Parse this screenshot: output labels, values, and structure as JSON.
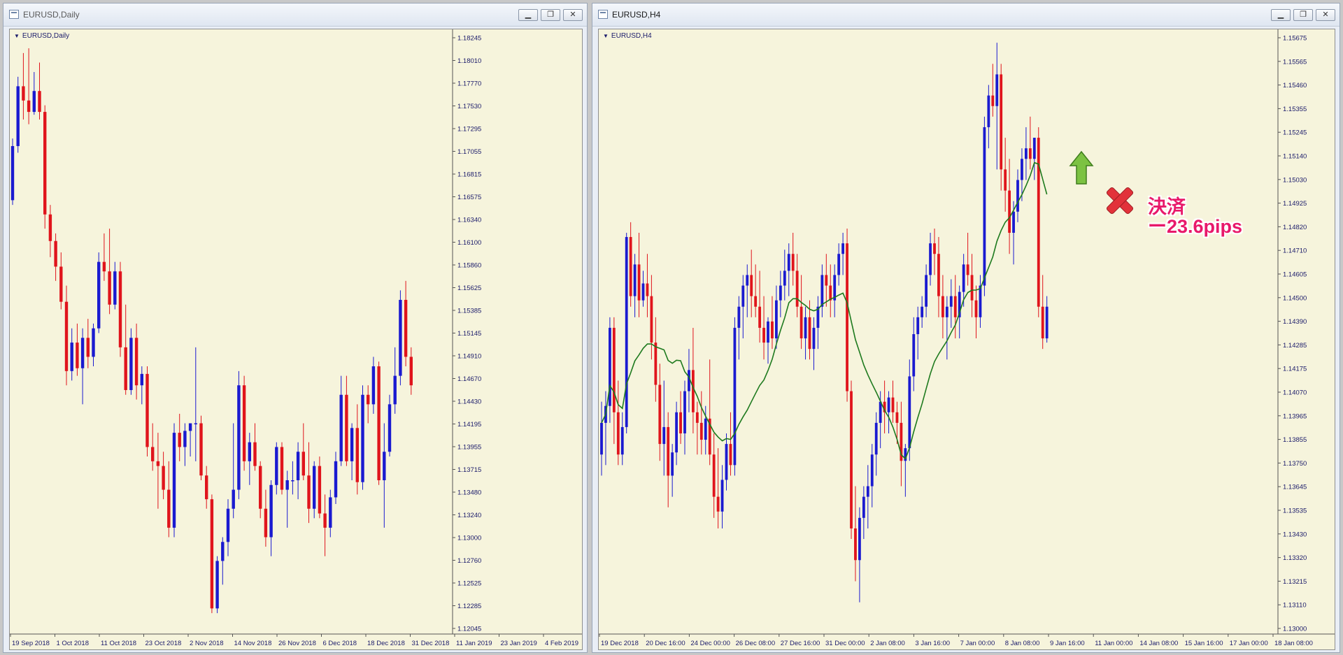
{
  "colors": {
    "bull": "#1a1ad0",
    "bear": "#e0141c",
    "ma": "#1e7a1e",
    "bg": "#f6f4dc",
    "axis": "#1a1a6a"
  },
  "left_window": {
    "title": "EURUSD,Daily",
    "symbol_label": "EURUSD,Daily",
    "buttons": [
      "minimize-icon",
      "restore-icon",
      "close-icon"
    ],
    "y_axis": [
      "1.18245",
      "1.18010",
      "1.17770",
      "1.17530",
      "1.17295",
      "1.17055",
      "1.16815",
      "1.16575",
      "1.16340",
      "1.16100",
      "1.15860",
      "1.15625",
      "1.15385",
      "1.15145",
      "1.14910",
      "1.14670",
      "1.14430",
      "1.14195",
      "1.13955",
      "1.13715",
      "1.13480",
      "1.13240",
      "1.13000",
      "1.12760",
      "1.12525",
      "1.12285",
      "1.12045"
    ],
    "x_axis": [
      "19 Sep 2018",
      "1 Oct 2018",
      "11 Oct 2018",
      "23 Oct 2018",
      "2 Nov 2018",
      "14 Nov 2018",
      "26 Nov 2018",
      "6 Dec 2018",
      "18 Dec 2018",
      "31 Dec 2018",
      "11 Jan 2019",
      "23 Jan 2019",
      "4 Feb 2019"
    ]
  },
  "right_window": {
    "title": "EURUSD,H4",
    "symbol_label": "EURUSD,H4",
    "buttons": [
      "minimize-icon",
      "restore-icon",
      "close-icon"
    ],
    "y_axis": [
      "1.15675",
      "1.15565",
      "1.15460",
      "1.15355",
      "1.15245",
      "1.15140",
      "1.15030",
      "1.14925",
      "1.14820",
      "1.14710",
      "1.14605",
      "1.14500",
      "1.14390",
      "1.14285",
      "1.14175",
      "1.14070",
      "1.13965",
      "1.13855",
      "1.13750",
      "1.13645",
      "1.13535",
      "1.13430",
      "1.13320",
      "1.13215",
      "1.13110",
      "1.13000"
    ],
    "x_axis": [
      "19 Dec 2018",
      "20 Dec 16:00",
      "24 Dec 00:00",
      "26 Dec 08:00",
      "27 Dec 16:00",
      "31 Dec 00:00",
      "2 Jan 08:00",
      "3 Jan 16:00",
      "7 Jan 00:00",
      "8 Jan 08:00",
      "9 Jan 16:00",
      "11 Jan 00:00",
      "14 Jan 08:00",
      "15 Jan 16:00",
      "17 Jan 00:00",
      "18 Jan 08:00"
    ],
    "annotation": {
      "line1": "決済",
      "line2": "ー23.6pips",
      "entry_icon": "up-arrow-icon",
      "exit_icon": "x-mark-icon"
    }
  },
  "chart_data": [
    {
      "type": "candlestick",
      "title": "EURUSD,Daily",
      "ylim": [
        1.1198,
        1.1832
      ],
      "x_ticks": [
        "19 Sep 2018",
        "1 Oct 2018",
        "11 Oct 2018",
        "23 Oct 2018",
        "2 Nov 2018",
        "14 Nov 2018",
        "26 Nov 2018",
        "6 Dec 2018",
        "18 Dec 2018",
        "31 Dec 2018",
        "11 Jan 2019",
        "23 Jan 2019",
        "4 Feb 2019"
      ],
      "ohlc": [
        [
          1.1655,
          1.172,
          1.165,
          1.1712
        ],
        [
          1.1712,
          1.1785,
          1.1705,
          1.1775
        ],
        [
          1.1775,
          1.181,
          1.174,
          1.176
        ],
        [
          1.176,
          1.1815,
          1.1735,
          1.1748
        ],
        [
          1.1748,
          1.179,
          1.1745,
          1.177
        ],
        [
          1.177,
          1.18,
          1.174,
          1.1748
        ],
        [
          1.1748,
          1.1755,
          1.1625,
          1.164
        ],
        [
          1.164,
          1.165,
          1.1595,
          1.1612
        ],
        [
          1.1612,
          1.162,
          1.157,
          1.1585
        ],
        [
          1.1585,
          1.16,
          1.154,
          1.1548
        ],
        [
          1.1548,
          1.1565,
          1.146,
          1.1475
        ],
        [
          1.1475,
          1.152,
          1.1465,
          1.1505
        ],
        [
          1.1505,
          1.1525,
          1.147,
          1.1478
        ],
        [
          1.1478,
          1.152,
          1.144,
          1.151
        ],
        [
          1.151,
          1.153,
          1.1478,
          1.149
        ],
        [
          1.149,
          1.1525,
          1.148,
          1.152
        ],
        [
          1.152,
          1.16,
          1.1515,
          1.159
        ],
        [
          1.159,
          1.162,
          1.157,
          1.158
        ],
        [
          1.158,
          1.1625,
          1.1535,
          1.1545
        ],
        [
          1.1545,
          1.159,
          1.154,
          1.158
        ],
        [
          1.158,
          1.159,
          1.149,
          1.15
        ],
        [
          1.15,
          1.1545,
          1.145,
          1.1455
        ],
        [
          1.1455,
          1.152,
          1.145,
          1.151
        ],
        [
          1.151,
          1.1525,
          1.1445,
          1.146
        ],
        [
          1.146,
          1.148,
          1.144,
          1.1472
        ],
        [
          1.1472,
          1.148,
          1.1385,
          1.1395
        ],
        [
          1.1395,
          1.142,
          1.137,
          1.138
        ],
        [
          1.138,
          1.141,
          1.133,
          1.1375
        ],
        [
          1.1375,
          1.139,
          1.134,
          1.135
        ],
        [
          1.135,
          1.138,
          1.13,
          1.131
        ],
        [
          1.131,
          1.142,
          1.13,
          1.141
        ],
        [
          1.141,
          1.143,
          1.138,
          1.1395
        ],
        [
          1.1395,
          1.142,
          1.1375,
          1.1412
        ],
        [
          1.1412,
          1.142,
          1.1385,
          1.142
        ],
        [
          1.142,
          1.15,
          1.138,
          1.142
        ],
        [
          1.142,
          1.1428,
          1.136,
          1.1365
        ],
        [
          1.1365,
          1.1375,
          1.133,
          1.134
        ],
        [
          1.134,
          1.1345,
          1.122,
          1.1225
        ],
        [
          1.1225,
          1.128,
          1.122,
          1.1275
        ],
        [
          1.1275,
          1.13,
          1.125,
          1.1295
        ],
        [
          1.1295,
          1.134,
          1.128,
          1.133
        ],
        [
          1.133,
          1.142,
          1.132,
          1.135
        ],
        [
          1.135,
          1.1475,
          1.134,
          1.146
        ],
        [
          1.146,
          1.147,
          1.137,
          1.138
        ],
        [
          1.138,
          1.141,
          1.1355,
          1.14
        ],
        [
          1.14,
          1.142,
          1.137,
          1.1375
        ],
        [
          1.1375,
          1.138,
          1.132,
          1.133
        ],
        [
          1.133,
          1.135,
          1.129,
          1.13
        ],
        [
          1.13,
          1.136,
          1.128,
          1.1355
        ],
        [
          1.1355,
          1.14,
          1.1345,
          1.1395
        ],
        [
          1.1395,
          1.14,
          1.1345,
          1.135
        ],
        [
          1.135,
          1.137,
          1.131,
          1.136
        ],
        [
          1.136,
          1.138,
          1.1345,
          1.136
        ],
        [
          1.136,
          1.14,
          1.134,
          1.139
        ],
        [
          1.139,
          1.142,
          1.136,
          1.1365
        ],
        [
          1.1365,
          1.14,
          1.1315,
          1.133
        ],
        [
          1.133,
          1.138,
          1.132,
          1.1375
        ],
        [
          1.1375,
          1.1385,
          1.132,
          1.1325
        ],
        [
          1.1325,
          1.1345,
          1.128,
          1.131
        ],
        [
          1.131,
          1.135,
          1.13,
          1.1342
        ],
        [
          1.1342,
          1.139,
          1.1335,
          1.138
        ],
        [
          1.138,
          1.147,
          1.1375,
          1.145
        ],
        [
          1.145,
          1.147,
          1.1375,
          1.138
        ],
        [
          1.138,
          1.142,
          1.136,
          1.1415
        ],
        [
          1.1415,
          1.144,
          1.1345,
          1.1358
        ],
        [
          1.1358,
          1.146,
          1.135,
          1.145
        ],
        [
          1.145,
          1.146,
          1.142,
          1.144
        ],
        [
          1.144,
          1.149,
          1.143,
          1.148
        ],
        [
          1.148,
          1.1485,
          1.1355,
          1.136
        ],
        [
          1.136,
          1.142,
          1.131,
          1.139
        ],
        [
          1.139,
          1.145,
          1.1385,
          1.144
        ],
        [
          1.144,
          1.15,
          1.143,
          1.147
        ],
        [
          1.147,
          1.156,
          1.146,
          1.155
        ],
        [
          1.155,
          1.157,
          1.148,
          1.149
        ],
        [
          1.149,
          1.15,
          1.145,
          1.146
        ]
      ]
    },
    {
      "type": "candlestick",
      "title": "EURUSD,H4",
      "ylim": [
        1.129,
        1.1575
      ],
      "x_ticks": [
        "19 Dec 2018",
        "20 Dec 16:00",
        "24 Dec 00:00",
        "26 Dec 08:00",
        "27 Dec 16:00",
        "31 Dec 00:00",
        "2 Jan 08:00",
        "3 Jan 16:00",
        "7 Jan 00:00",
        "8 Jan 08:00",
        "9 Jan 16:00",
        "11 Jan 00:00",
        "14 Jan 08:00",
        "15 Jan 16:00",
        "17 Jan 00:00",
        "18 Jan 08:00"
      ],
      "moving_average": "green line shown (smoothing of closes)",
      "ohlc": [
        [
          1.1375,
          1.14,
          1.1365,
          1.139
        ],
        [
          1.139,
          1.1405,
          1.137,
          1.1398
        ],
        [
          1.1398,
          1.144,
          1.139,
          1.1435
        ],
        [
          1.1435,
          1.144,
          1.138,
          1.1395
        ],
        [
          1.1395,
          1.141,
          1.137,
          1.1375
        ],
        [
          1.1375,
          1.1395,
          1.137,
          1.1388
        ],
        [
          1.1388,
          1.148,
          1.1385,
          1.1478
        ],
        [
          1.1478,
          1.1485,
          1.1445,
          1.145
        ],
        [
          1.145,
          1.147,
          1.144,
          1.1465
        ],
        [
          1.1465,
          1.148,
          1.144,
          1.1448
        ],
        [
          1.1448,
          1.1462,
          1.1445,
          1.1456
        ],
        [
          1.1456,
          1.147,
          1.144,
          1.145
        ],
        [
          1.145,
          1.146,
          1.142,
          1.1428
        ],
        [
          1.1428,
          1.144,
          1.14,
          1.1408
        ],
        [
          1.1408,
          1.1418,
          1.1372,
          1.138
        ],
        [
          1.138,
          1.141,
          1.1365,
          1.1388
        ],
        [
          1.1388,
          1.1395,
          1.135,
          1.1365
        ],
        [
          1.1365,
          1.138,
          1.1355,
          1.1376
        ],
        [
          1.1376,
          1.14,
          1.137,
          1.1395
        ],
        [
          1.1395,
          1.1405,
          1.138,
          1.1385
        ],
        [
          1.1385,
          1.141,
          1.1375,
          1.1405
        ],
        [
          1.1405,
          1.1425,
          1.1395,
          1.1415
        ],
        [
          1.1415,
          1.1435,
          1.1385,
          1.1395
        ],
        [
          1.1395,
          1.14,
          1.1375,
          1.139
        ],
        [
          1.139,
          1.1405,
          1.1375,
          1.1382
        ],
        [
          1.1382,
          1.1398,
          1.1375,
          1.1392
        ],
        [
          1.1392,
          1.142,
          1.137,
          1.1375
        ],
        [
          1.1375,
          1.1385,
          1.1345,
          1.1355
        ],
        [
          1.1355,
          1.1378,
          1.134,
          1.1348
        ],
        [
          1.1348,
          1.137,
          1.134,
          1.1363
        ],
        [
          1.1363,
          1.1385,
          1.1358,
          1.138
        ],
        [
          1.138,
          1.1395,
          1.1365,
          1.137
        ],
        [
          1.137,
          1.144,
          1.1365,
          1.1435
        ],
        [
          1.1435,
          1.145,
          1.142,
          1.1445
        ],
        [
          1.1445,
          1.146,
          1.143,
          1.1455
        ],
        [
          1.1455,
          1.1465,
          1.144,
          1.146
        ],
        [
          1.146,
          1.1472,
          1.144,
          1.145
        ],
        [
          1.145,
          1.1465,
          1.144,
          1.1445
        ],
        [
          1.1445,
          1.1462,
          1.1428,
          1.1435
        ],
        [
          1.1435,
          1.145,
          1.142,
          1.1428
        ],
        [
          1.1428,
          1.144,
          1.1418,
          1.1438
        ],
        [
          1.1438,
          1.145,
          1.1425,
          1.143
        ],
        [
          1.143,
          1.1455,
          1.1425,
          1.1448
        ],
        [
          1.1448,
          1.1462,
          1.144,
          1.1455
        ],
        [
          1.1455,
          1.1472,
          1.1448,
          1.1462
        ],
        [
          1.1462,
          1.1475,
          1.145,
          1.147
        ],
        [
          1.147,
          1.148,
          1.1455,
          1.1462
        ],
        [
          1.1462,
          1.147,
          1.144,
          1.1445
        ],
        [
          1.1445,
          1.146,
          1.1425,
          1.143
        ],
        [
          1.143,
          1.1445,
          1.142,
          1.144
        ],
        [
          1.144,
          1.1448,
          1.142,
          1.1425
        ],
        [
          1.1425,
          1.144,
          1.1415,
          1.1435
        ],
        [
          1.1435,
          1.145,
          1.1425,
          1.1445
        ],
        [
          1.1445,
          1.1465,
          1.144,
          1.146
        ],
        [
          1.146,
          1.147,
          1.1445,
          1.1455
        ],
        [
          1.1455,
          1.1465,
          1.144,
          1.1448
        ],
        [
          1.1448,
          1.1465,
          1.144,
          1.146
        ],
        [
          1.146,
          1.1475,
          1.1455,
          1.147
        ],
        [
          1.147,
          1.148,
          1.146,
          1.1475
        ],
        [
          1.1475,
          1.1482,
          1.14,
          1.1405
        ],
        [
          1.1405,
          1.141,
          1.1335,
          1.134
        ],
        [
          1.134,
          1.136,
          1.1315,
          1.1325
        ],
        [
          1.1325,
          1.135,
          1.1305,
          1.1345
        ],
        [
          1.1345,
          1.136,
          1.1335,
          1.1355
        ],
        [
          1.1355,
          1.137,
          1.134,
          1.136
        ],
        [
          1.136,
          1.138,
          1.135,
          1.1375
        ],
        [
          1.1375,
          1.1395,
          1.1365,
          1.139
        ],
        [
          1.139,
          1.1405,
          1.1378,
          1.14
        ],
        [
          1.14,
          1.141,
          1.1385,
          1.1395
        ],
        [
          1.1395,
          1.1405,
          1.1385,
          1.1402
        ],
        [
          1.1402,
          1.141,
          1.139,
          1.1395
        ],
        [
          1.1395,
          1.14,
          1.138,
          1.139
        ],
        [
          1.139,
          1.14,
          1.136,
          1.1372
        ],
        [
          1.1372,
          1.138,
          1.1355,
          1.1378
        ],
        [
          1.1378,
          1.142,
          1.1372,
          1.1412
        ],
        [
          1.1412,
          1.144,
          1.1405,
          1.1432
        ],
        [
          1.1432,
          1.1445,
          1.142,
          1.144
        ],
        [
          1.144,
          1.145,
          1.1435,
          1.1445
        ],
        [
          1.1445,
          1.1465,
          1.144,
          1.146
        ],
        [
          1.146,
          1.148,
          1.1455,
          1.1475
        ],
        [
          1.1475,
          1.1482,
          1.146,
          1.147
        ],
        [
          1.147,
          1.1478,
          1.144,
          1.145
        ],
        [
          1.145,
          1.146,
          1.143,
          1.144
        ],
        [
          1.144,
          1.145,
          1.142,
          1.1445
        ],
        [
          1.1445,
          1.1458,
          1.1435,
          1.145
        ],
        [
          1.145,
          1.146,
          1.143,
          1.144
        ],
        [
          1.144,
          1.1455,
          1.143,
          1.1452
        ],
        [
          1.1452,
          1.147,
          1.1445,
          1.1465
        ],
        [
          1.1465,
          1.148,
          1.1455,
          1.146
        ],
        [
          1.146,
          1.147,
          1.144,
          1.1448
        ],
        [
          1.1448,
          1.1455,
          1.143,
          1.144
        ],
        [
          1.144,
          1.146,
          1.1435,
          1.1455
        ],
        [
          1.1455,
          1.1535,
          1.145,
          1.153
        ],
        [
          1.153,
          1.155,
          1.152,
          1.1545
        ],
        [
          1.1545,
          1.156,
          1.1535,
          1.154
        ],
        [
          1.154,
          1.157,
          1.151,
          1.1555
        ],
        [
          1.1555,
          1.156,
          1.15,
          1.151
        ],
        [
          1.151,
          1.1525,
          1.149,
          1.15
        ],
        [
          1.15,
          1.1515,
          1.147,
          1.148
        ],
        [
          1.148,
          1.1495,
          1.1465,
          1.149
        ],
        [
          1.149,
          1.151,
          1.1485,
          1.1505
        ],
        [
          1.1505,
          1.152,
          1.1495,
          1.1515
        ],
        [
          1.1515,
          1.153,
          1.1505,
          1.152
        ],
        [
          1.152,
          1.1535,
          1.151,
          1.1515
        ],
        [
          1.1515,
          1.1525,
          1.1505,
          1.1525
        ],
        [
          1.1525,
          1.153,
          1.144,
          1.1445
        ],
        [
          1.1445,
          1.146,
          1.1425,
          1.143
        ],
        [
          1.143,
          1.145,
          1.1428,
          1.1445
        ]
      ]
    }
  ]
}
